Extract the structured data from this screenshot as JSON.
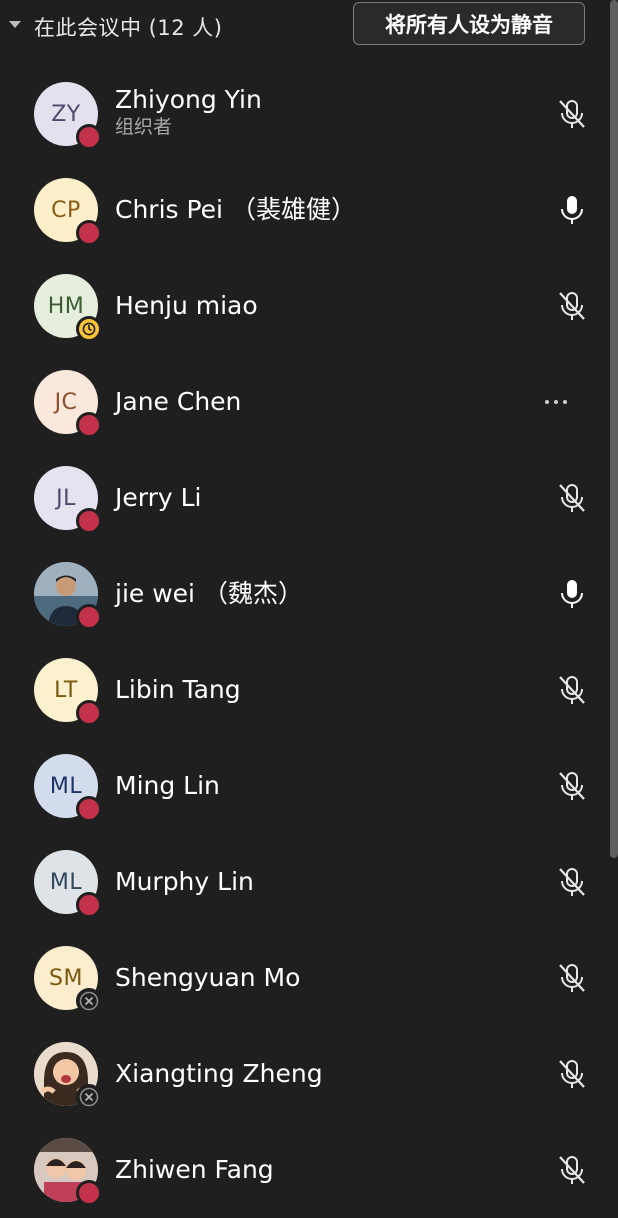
{
  "header": {
    "section_title": "在此会议中 (12 人)",
    "mute_all_label": "将所有人设为静音"
  },
  "colors": {
    "background": "#1f1f1f",
    "busy": "#c4314b",
    "away": "#f8c338",
    "text": "#ffffff",
    "subtext": "#a8a8a8"
  },
  "participants": [
    {
      "initials": "ZY",
      "name": "Zhiyong Yin",
      "role": "组织者",
      "status": "busy",
      "mic": "muted",
      "avatar_bg": "#e3e1ee",
      "avatar_fg": "#4b4a6e"
    },
    {
      "initials": "CP",
      "name": "Chris Pei （裴雄健）",
      "role": "",
      "status": "busy",
      "mic": "on",
      "avatar_bg": "#fcefca",
      "avatar_fg": "#8a5c16"
    },
    {
      "initials": "HM",
      "name": "Henju miao",
      "role": "",
      "status": "away",
      "mic": "muted",
      "avatar_bg": "#e6efde",
      "avatar_fg": "#3f5d33"
    },
    {
      "initials": "JC",
      "name": "Jane Chen",
      "role": "",
      "status": "busy",
      "mic": "more",
      "avatar_bg": "#fbe8dc",
      "avatar_fg": "#8a4f2a"
    },
    {
      "initials": "JL",
      "name": "Jerry Li",
      "role": "",
      "status": "busy",
      "mic": "muted",
      "avatar_bg": "#e5e3ef",
      "avatar_fg": "#4b4a6e"
    },
    {
      "initials": "",
      "name": "jie wei （魏杰）",
      "role": "",
      "status": "busy",
      "mic": "on",
      "avatar_bg": "#7a8ea0",
      "avatar_fg": "#ffffff",
      "photo": "man-photo"
    },
    {
      "initials": "LT",
      "name": "Libin Tang",
      "role": "",
      "status": "busy",
      "mic": "muted",
      "avatar_bg": "#fcf1cf",
      "avatar_fg": "#7a5a10"
    },
    {
      "initials": "ML",
      "name": "Ming Lin",
      "role": "",
      "status": "busy",
      "mic": "muted",
      "avatar_bg": "#d3dcec",
      "avatar_fg": "#1d3266"
    },
    {
      "initials": "ML",
      "name": "Murphy Lin",
      "role": "",
      "status": "busy",
      "mic": "muted",
      "avatar_bg": "#dde3e6",
      "avatar_fg": "#33475a"
    },
    {
      "initials": "SM",
      "name": "Shengyuan Mo",
      "role": "",
      "status": "offline",
      "mic": "muted",
      "avatar_bg": "#fbedcd",
      "avatar_fg": "#7a5a10"
    },
    {
      "initials": "",
      "name": "Xiangting Zheng",
      "role": "",
      "status": "offline",
      "mic": "muted",
      "avatar_bg": "#d7b49a",
      "avatar_fg": "#ffffff",
      "photo": "woman-photo"
    },
    {
      "initials": "",
      "name": "Zhiwen Fang",
      "role": "",
      "status": "busy",
      "mic": "muted",
      "avatar_bg": "#b98d75",
      "avatar_fg": "#ffffff",
      "photo": "kids-photo"
    }
  ]
}
